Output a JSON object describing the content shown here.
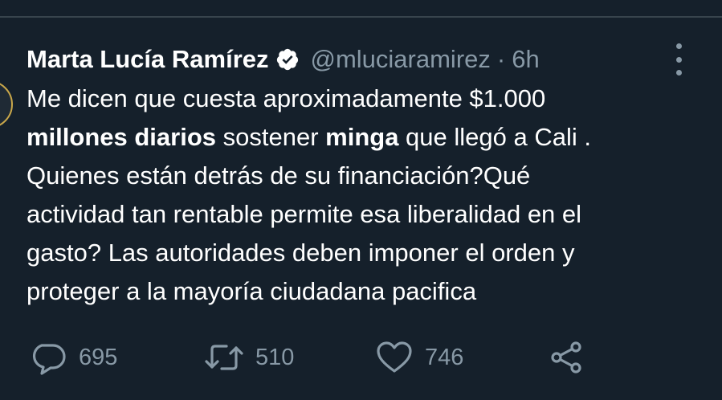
{
  "tweet": {
    "author_name": "Marta Lucía Ramírez",
    "handle": "@mluciaramirez",
    "separator": "·",
    "time": "6h",
    "lines": [
      [
        {
          "t": "Me dicen que cuesta aproximadamente $1.000",
          "b": false
        }
      ],
      [
        {
          "t": "millones diarios",
          "b": true
        },
        {
          "t": " sostener ",
          "b": false
        },
        {
          "t": "minga",
          "b": true
        },
        {
          "t": " que llegó a Cali .",
          "b": false
        }
      ],
      [
        {
          "t": "Quienes están detrás de su financiación?Qué",
          "b": false
        }
      ],
      [
        {
          "t": "actividad tan rentable permite esa liberalidad en el",
          "b": false
        }
      ],
      [
        {
          "t": "gasto? Las autoridades deben imponer el orden y",
          "b": false
        }
      ],
      [
        {
          "t": "proteger a la mayoría ciudadana pacifica",
          "b": false
        }
      ]
    ]
  },
  "actions": {
    "reply_count": "695",
    "retweet_count": "510",
    "like_count": "746"
  },
  "icons": {
    "verified": "verified-badge-icon",
    "more": "more-vertical-icon",
    "reply": "reply-icon",
    "retweet": "retweet-icon",
    "like": "heart-icon",
    "share": "share-icon"
  },
  "colors": {
    "background": "#15202b",
    "text": "#ffffff",
    "secondary": "#8899a6",
    "divider": "#38444d"
  }
}
